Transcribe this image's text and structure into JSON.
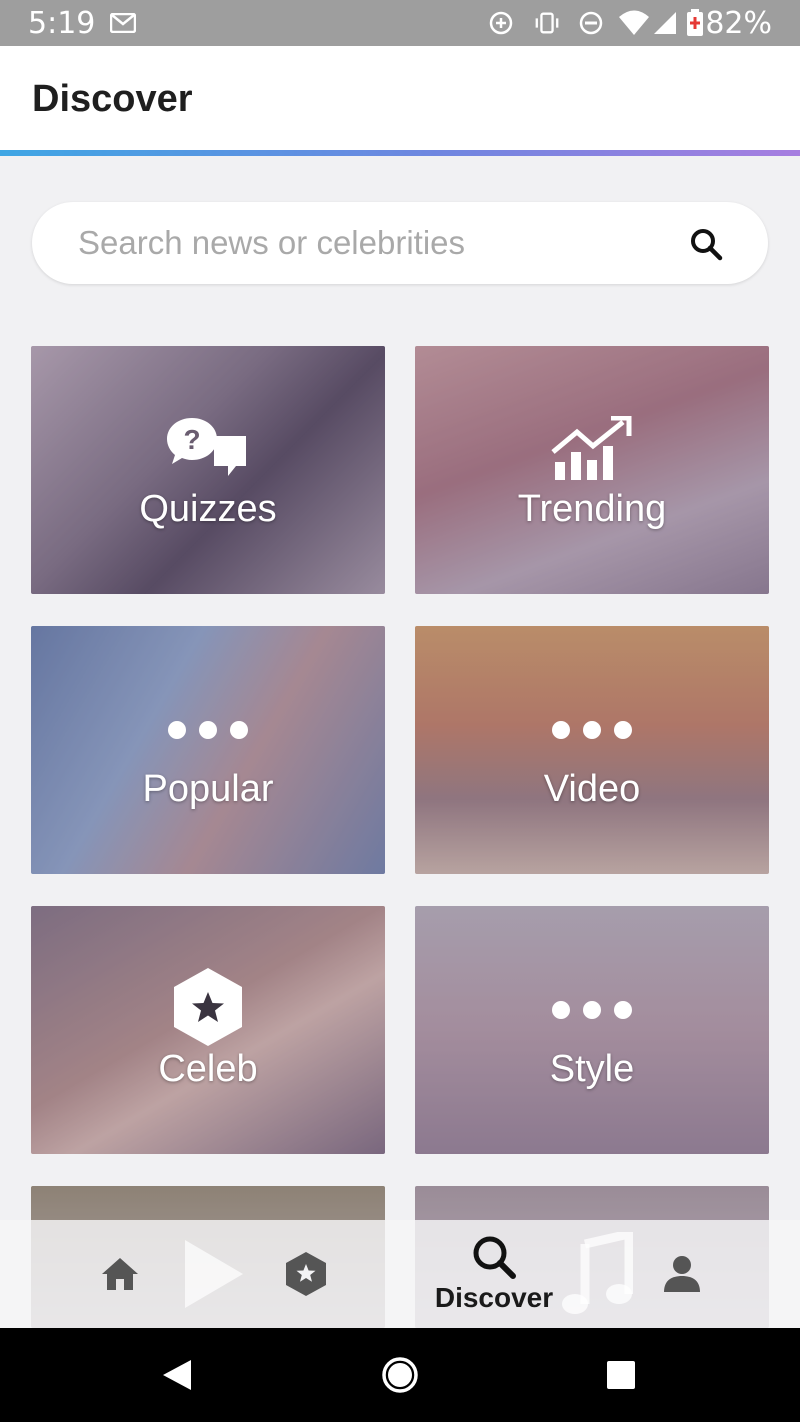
{
  "status_bar": {
    "time": "5:19",
    "battery": "82%",
    "icons": [
      "gmail-icon",
      "data-saver-icon",
      "vibrate-icon",
      "do-not-disturb-icon",
      "wifi-icon",
      "signal-icon",
      "battery-icon"
    ]
  },
  "header": {
    "title": "Discover",
    "accent_gradient": [
      "#3fa6e4",
      "#a77ee0"
    ]
  },
  "search": {
    "placeholder": "Search news or celebrities",
    "value": ""
  },
  "tiles": [
    {
      "label": "Quizzes",
      "icon": "quiz-icon"
    },
    {
      "label": "Trending",
      "icon": "trending-icon"
    },
    {
      "label": "Popular",
      "icon": "dots-icon"
    },
    {
      "label": "Video",
      "icon": "dots-icon"
    },
    {
      "label": "Celeb",
      "icon": "celeb-star-icon"
    },
    {
      "label": "Style",
      "icon": "dots-icon"
    }
  ],
  "bottom_nav": {
    "items": [
      {
        "icon": "home-icon"
      },
      {
        "icon": "play-icon"
      },
      {
        "icon": "celeb-star-icon"
      },
      {
        "icon": "search-icon",
        "label": "Discover",
        "active": true
      },
      {
        "icon": "music-icon"
      },
      {
        "icon": "profile-icon"
      }
    ]
  },
  "system_nav": {
    "buttons": [
      "back-icon",
      "home-circle-icon",
      "recents-icon"
    ]
  }
}
